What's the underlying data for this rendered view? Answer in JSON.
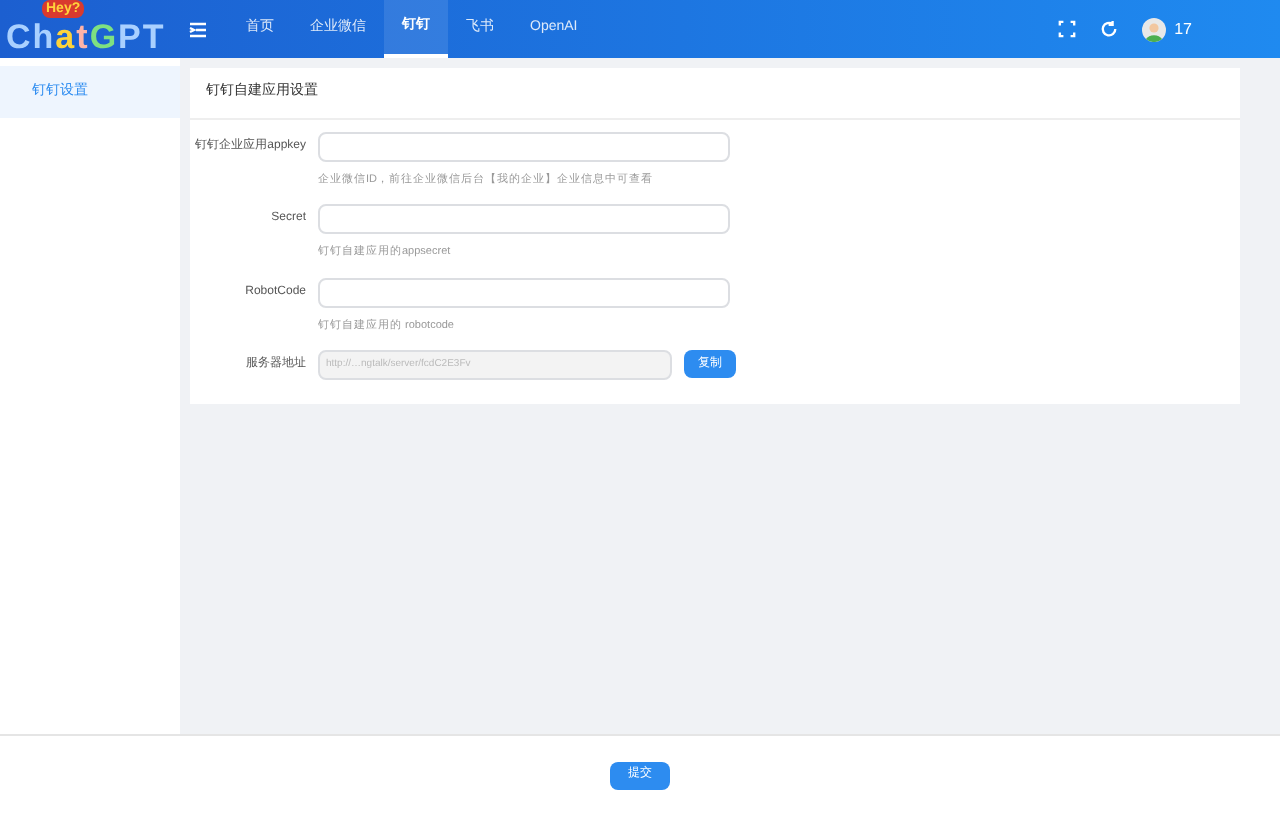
{
  "logo": {
    "text": "ChatGPT",
    "badge": "Hey?"
  },
  "nav": [
    {
      "label": "首页",
      "selected": false
    },
    {
      "label": "企业微信",
      "selected": false
    },
    {
      "label": "钉钉",
      "selected": true
    },
    {
      "label": "飞书",
      "selected": false
    },
    {
      "label": "OpenAI",
      "selected": false
    }
  ],
  "user": {
    "name": "17"
  },
  "sidebar": {
    "items": [
      {
        "label": "钉钉设置",
        "selected": true
      }
    ]
  },
  "card": {
    "title": "钉钉自建应用设置",
    "fields": [
      {
        "kind": "input",
        "label": "钉钉企业应用appkey",
        "hint": "企业微信ID，前往企业微信后台【我的企业】企业信息中可查看"
      },
      {
        "kind": "input",
        "label": "Secret",
        "hint": "钉钉自建应用的appsecret"
      },
      {
        "kind": "input",
        "label": "RobotCode",
        "hint": "钉钉自建应用的 robotcode"
      },
      {
        "kind": "readonly",
        "label": "服务器地址",
        "value": "http://…ngtalk/server/fcdC2E3Fv",
        "button": "复制"
      }
    ]
  },
  "footer": {
    "button": "提交"
  }
}
